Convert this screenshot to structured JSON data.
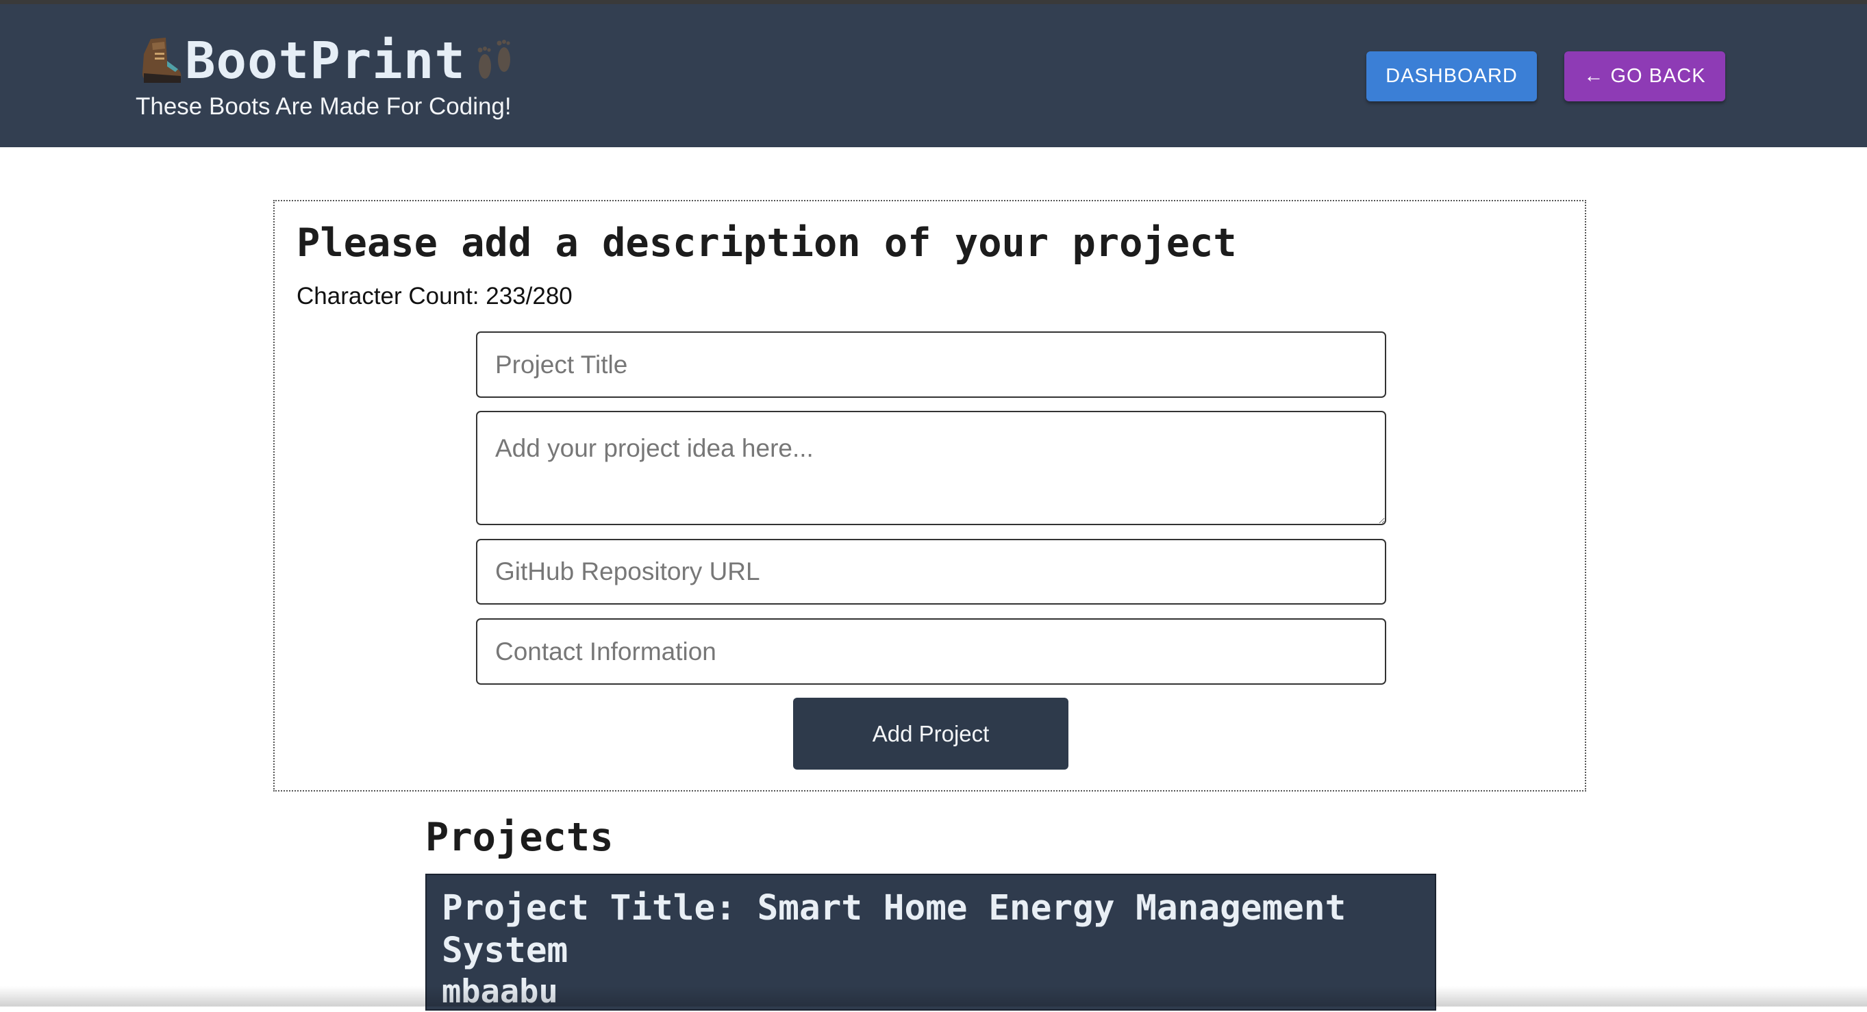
{
  "header": {
    "brand_title": "BootPrint",
    "tagline": "These Boots Are Made For Coding!",
    "boot_icon": "hiking-boot-icon",
    "footprints_icon": "footprints-icon",
    "dashboard_label": "DASHBOARD",
    "go_back_label": "← GO BACK",
    "background_color": "#333f51",
    "dashboard_color": "#3b7fd6",
    "go_back_color": "#8e3bb5"
  },
  "form": {
    "heading": "Please add a description of your project",
    "char_count": "Character Count: 233/280",
    "title_placeholder": "Project Title",
    "description_placeholder": "Add your project idea here...",
    "github_placeholder": "GitHub Repository URL",
    "contact_placeholder": "Contact Information",
    "submit_label": "Add Project",
    "submit_color": "#2e3a4b"
  },
  "projects": {
    "heading": "Projects",
    "items": [
      {
        "title": "Project Title: Smart Home Energy Management System",
        "user": "mbaabu"
      }
    ]
  }
}
